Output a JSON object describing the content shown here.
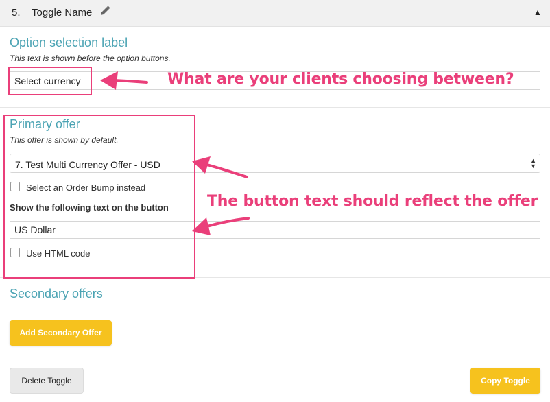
{
  "header": {
    "number": "5.",
    "title": "Toggle Name",
    "pencil_icon": "pencil-icon",
    "collapse_icon": "triangle-up-icon"
  },
  "option_label": {
    "title": "Option selection label",
    "hint": "This text is shown before the option buttons.",
    "value": "Select currency"
  },
  "primary_offer": {
    "title": "Primary offer",
    "hint": "This offer is shown by default.",
    "selected_offer": "7. Test Multi Currency Offer - USD",
    "order_bump_label": "Select an Order Bump instead",
    "button_text_label": "Show the following text on the button",
    "button_text_value": "US Dollar",
    "html_code_label": "Use HTML code"
  },
  "secondary_offers": {
    "title": "Secondary offers",
    "add_button": "Add Secondary Offer"
  },
  "footer": {
    "delete_button": "Delete Toggle",
    "copy_button": "Copy Toggle"
  },
  "annotations": {
    "clients_choosing": "What are your clients choosing between?",
    "button_text_reflect": "The button text should reflect the offer"
  },
  "colors": {
    "accent_teal": "#4aa3b3",
    "highlight_pink": "#ea3f7a",
    "button_yellow": "#f6c21e"
  }
}
